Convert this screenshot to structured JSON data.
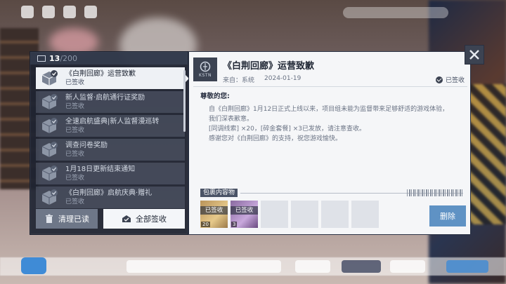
{
  "mailbox": {
    "count_current": "13",
    "count_total": "/200",
    "items": [
      {
        "title": "《白荆回廊》运营致歉",
        "status": "已签收"
      },
      {
        "title": "新人监督·启航通行证奖励",
        "status": "已签收"
      },
      {
        "title": "全速启航盛典|新人监督漫巡转",
        "status": "已签收"
      },
      {
        "title": "调查问卷奖励",
        "status": "已签收"
      },
      {
        "title": "1月18日更新结束通知",
        "status": "已签收"
      },
      {
        "title": "《白荆回廊》启航庆典·赠礼",
        "status": "已签收"
      }
    ],
    "clear_read_label": "清理已读",
    "claim_all_label": "全部签收"
  },
  "detail": {
    "title": "《白荆回廊》运营致歉",
    "sender_prefix": "来自：",
    "sender": "系统",
    "date": "2024-01-19",
    "signed_label": "已签收",
    "logo_text": "KSTN",
    "greeting": "尊敬的您:",
    "body_lines": [
      "自《白荆回廊》1月12日正式上线以来，项目组未能为监督带来足够舒适的游戏体验，",
      "我们深表歉意。",
      "[同调线索] ×20，[碎金套餐] ×3已发放，请注意查收。",
      "感谢您对《白荆回廊》的支持，祝您游戏愉快。"
    ],
    "attachments_label": "包裹内容物",
    "attachments": [
      {
        "state": "已签收",
        "qty": "20"
      },
      {
        "state": "已签收",
        "qty": "3"
      }
    ],
    "empty_slots": 4,
    "delete_label": "删除"
  },
  "colors": {
    "accent_blue": "#5f92c4",
    "panel_dark": "#1e2432",
    "panel_light": "#f5f6f8"
  },
  "icons": [
    "mail-icon",
    "box-check-icon",
    "trash-icon",
    "claim-icon",
    "check-circle-icon",
    "close-icon"
  ]
}
